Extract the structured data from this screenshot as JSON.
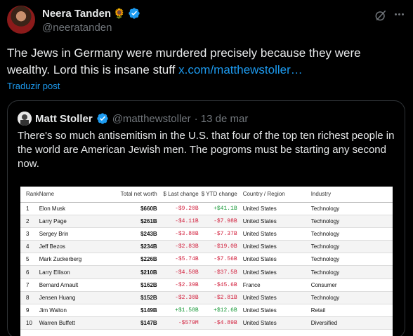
{
  "author": {
    "name": "Neera Tanden",
    "emoji": "🌻",
    "handle": "@neeratanden"
  },
  "tweet": {
    "text": "The Jews in Germany were murdered precisely because they were wealthy.  Lord this is insane stuff ",
    "link": "x.com/matthewstoller…",
    "translate_label": "Traduzir post"
  },
  "quote": {
    "name": "Matt Stoller",
    "handle": "@matthewstoller",
    "date": "· 13 de mar",
    "text": "There's so much antisemitism in the U.S. that four of the top ten richest people in the world are American Jewish men. The pogroms must be starting any second now."
  },
  "table": {
    "headers": [
      "Rank",
      "Name",
      "Total net worth",
      "$ Last change",
      "$ YTD change",
      "Country / Region",
      "Industry"
    ],
    "rows": [
      {
        "rank": "1",
        "name": "Elon Musk",
        "net": "$660B",
        "last": "-$9.20B",
        "last_sign": "neg",
        "ytd": "+$41.1B",
        "ytd_sign": "pos",
        "country": "United States",
        "industry": "Technology"
      },
      {
        "rank": "2",
        "name": "Larry Page",
        "net": "$261B",
        "last": "-$4.11B",
        "last_sign": "neg",
        "ytd": "-$7.98B",
        "ytd_sign": "neg",
        "country": "United States",
        "industry": "Technology"
      },
      {
        "rank": "3",
        "name": "Sergey Brin",
        "net": "$243B",
        "last": "-$3.80B",
        "last_sign": "neg",
        "ytd": "-$7.37B",
        "ytd_sign": "neg",
        "country": "United States",
        "industry": "Technology"
      },
      {
        "rank": "4",
        "name": "Jeff Bezos",
        "net": "$234B",
        "last": "-$2.83B",
        "last_sign": "neg",
        "ytd": "-$19.0B",
        "ytd_sign": "neg",
        "country": "United States",
        "industry": "Technology"
      },
      {
        "rank": "5",
        "name": "Mark Zuckerberg",
        "net": "$226B",
        "last": "-$5.74B",
        "last_sign": "neg",
        "ytd": "-$7.56B",
        "ytd_sign": "neg",
        "country": "United States",
        "industry": "Technology"
      },
      {
        "rank": "6",
        "name": "Larry Ellison",
        "net": "$210B",
        "last": "-$4.58B",
        "last_sign": "neg",
        "ytd": "-$37.5B",
        "ytd_sign": "neg",
        "country": "United States",
        "industry": "Technology"
      },
      {
        "rank": "7",
        "name": "Bernard Arnault",
        "net": "$162B",
        "last": "-$2.39B",
        "last_sign": "neg",
        "ytd": "-$45.6B",
        "ytd_sign": "neg",
        "country": "France",
        "industry": "Consumer"
      },
      {
        "rank": "8",
        "name": "Jensen Huang",
        "net": "$152B",
        "last": "-$2.30B",
        "last_sign": "neg",
        "ytd": "-$2.81B",
        "ytd_sign": "neg",
        "country": "United States",
        "industry": "Technology"
      },
      {
        "rank": "9",
        "name": "Jim Walton",
        "net": "$149B",
        "last": "+$1.58B",
        "last_sign": "pos",
        "ytd": "+$12.6B",
        "ytd_sign": "pos",
        "country": "United States",
        "industry": "Retail"
      },
      {
        "rank": "10",
        "name": "Warren Buffett",
        "net": "$147B",
        "last": "-$579M",
        "last_sign": "neg",
        "ytd": "-$4.89B",
        "ytd_sign": "neg",
        "country": "United States",
        "industry": "Diversified"
      }
    ]
  },
  "icons": {
    "verified": "verified-badge-icon",
    "grok": "grok-icon",
    "more": "more-options-icon"
  },
  "colors": {
    "background": "#000000",
    "text": "#e7e9ea",
    "muted": "#71767b",
    "link": "#1d9bf0",
    "negative": "#d21f3c",
    "positive": "#1a9a3a"
  }
}
